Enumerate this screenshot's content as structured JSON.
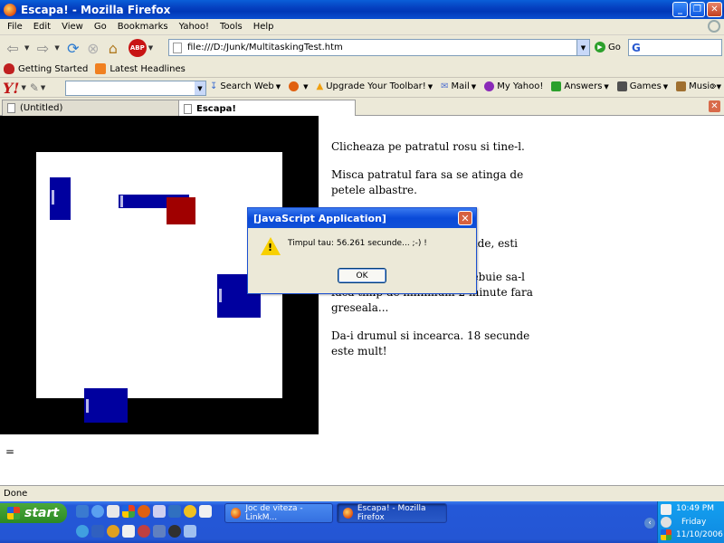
{
  "window": {
    "title": "Escapa! - Mozilla Firefox"
  },
  "menu": [
    "File",
    "Edit",
    "View",
    "Go",
    "Bookmarks",
    "Yahoo!",
    "Tools",
    "Help"
  ],
  "nav": {
    "url": "file:///D:/Junk/MultitaskingTest.htm",
    "go_label": "Go",
    "abp_label": "ABP"
  },
  "bookmarks": [
    "Getting Started",
    "Latest Headlines"
  ],
  "yahoo": {
    "logo": "Y!",
    "items": [
      {
        "label": "Search Web",
        "color": "#3a6ad0"
      },
      {
        "label": "",
        "color": "#e06010"
      },
      {
        "label": "Upgrade Your Toolbar!",
        "color": "#f0a010"
      },
      {
        "label": "Mail",
        "color": "#5070d0"
      },
      {
        "label": "My Yahoo!",
        "color": "#8a2ab8"
      },
      {
        "label": "Answers",
        "color": "#2ca02c"
      },
      {
        "label": "Games",
        "color": "#505050"
      },
      {
        "label": "Music",
        "color": "#a07030"
      }
    ],
    "more": "»"
  },
  "tabs": [
    {
      "label": "(Untitled)",
      "active": false
    },
    {
      "label": "Escapa!",
      "active": true
    }
  ],
  "game": {
    "background": "#000000",
    "field_color": "#ffffff",
    "enemy_color": "#00009f",
    "player_color": "#a00000"
  },
  "instructions": [
    "Clicheaza pe patratul rosu si tine-l.",
    "Misca patratul fara sa se atinga de petele albastre.",
    "",
    "nde, esti",
    "Viitorii piloti americani trebuie sa-l faca timp de minimum 2 minute fara greseala...",
    "Da-i drumul si incearca. 18 secunde este mult!"
  ],
  "equals": "=",
  "dialog": {
    "title": "[JavaScript Application]",
    "message": "Timpul tau: 56.261 secunde... ;-) !",
    "ok": "OK"
  },
  "status": "Done",
  "taskbar": {
    "start": "start",
    "tasks": [
      {
        "label": "Joc de viteza - LinkM...",
        "active": false
      },
      {
        "label": "Escapa! - Mozilla Firefox",
        "active": true
      }
    ],
    "time": "10:49 PM",
    "day": "Friday",
    "date": "11/10/2006"
  }
}
